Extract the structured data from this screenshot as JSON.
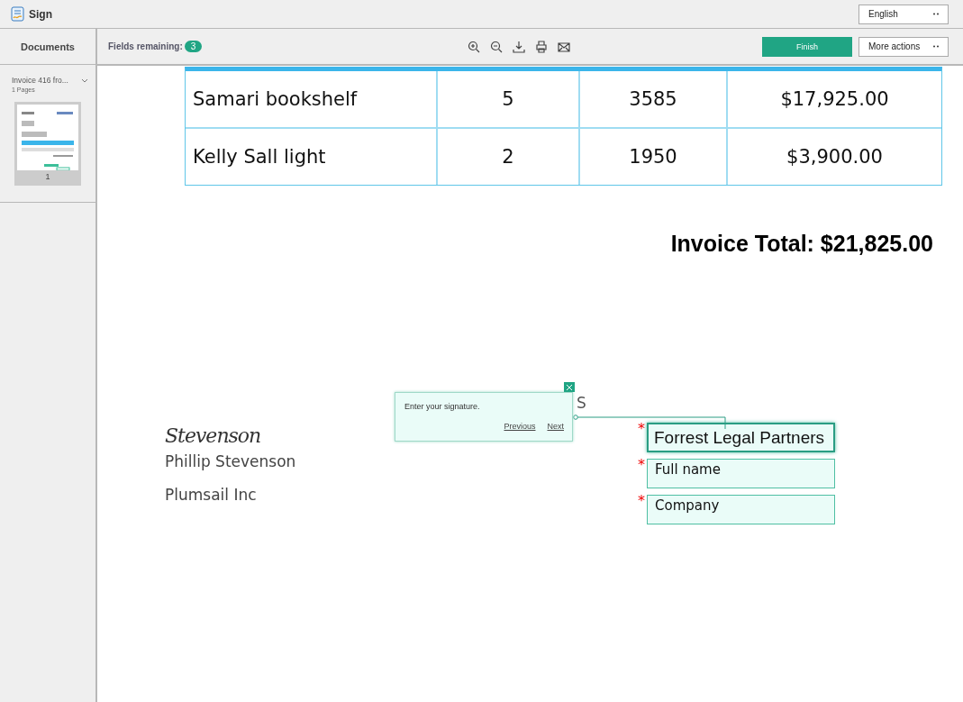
{
  "window": {
    "title": "Sign"
  },
  "language": {
    "value": "English"
  },
  "sidebar": {
    "title": "Documents",
    "documents": [
      {
        "name": "Invoice 416 fro...",
        "pages": "1 Pages",
        "expanded": true,
        "thumbnail": {
          "kind": "picture",
          "page_number": "1"
        }
      }
    ]
  },
  "toolbar": {
    "fields_label": "Fields remaining:",
    "fields_count": "3",
    "finish": "Finish",
    "more_actions": "More actions"
  },
  "table": {
    "rows": [
      [
        "Samari bookshelf",
        "5",
        "3585",
        "$17,925.00"
      ],
      [
        "Kelly Sall light",
        "2",
        "1950",
        "$3,900.00"
      ]
    ]
  },
  "invoice_total": "Invoice Total: $21,825.00",
  "signer": {
    "signature": "Stevenson",
    "name": "Phillip Stevenson",
    "company": "Plumsail Inc"
  },
  "covered_label": "S",
  "tooltip": {
    "text": "Enter your signature.",
    "previous": "Previous",
    "next": "Next"
  },
  "fields": [
    {
      "value": "Forrest Legal Partners",
      "required_mark": "*",
      "required": true,
      "focused": true
    },
    {
      "placeholder": "Full name",
      "required_mark": "*",
      "required": true,
      "focused": false
    },
    {
      "placeholder": "Company",
      "required_mark": "*",
      "required": true,
      "focused": false
    }
  ]
}
